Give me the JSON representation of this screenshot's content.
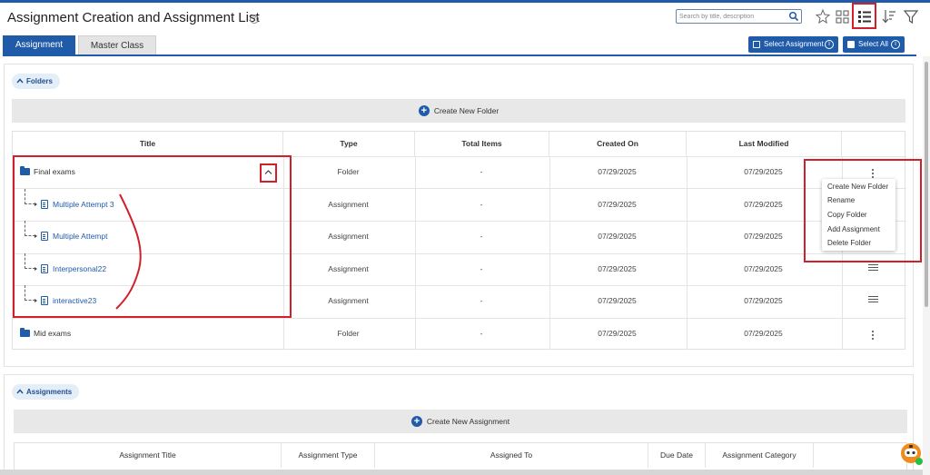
{
  "header": {
    "title": "Assignment Creation and Assignment List",
    "help_icon": "?",
    "search_placeholder": "Search by title, description"
  },
  "tabs": [
    {
      "label": "Assignment",
      "active": true
    },
    {
      "label": "Master Class",
      "active": false
    }
  ],
  "actions": {
    "select_assignment": "Select Assignment",
    "select_all": "Select All"
  },
  "folders_section": {
    "chip": "Folders",
    "create_label": "Create New Folder",
    "columns": [
      "Title",
      "Type",
      "Total Items",
      "Created On",
      "Last Modified"
    ],
    "rows": [
      {
        "title": "Final exams",
        "type": "Folder",
        "total": "-",
        "created": "07/29/2025",
        "modified": "07/29/2025"
      },
      {
        "title": "Multiple Attempt 3",
        "type": "Assignment",
        "total": "-",
        "created": "07/29/2025",
        "modified": "07/29/2025"
      },
      {
        "title": "Multiple Attempt",
        "type": "Assignment",
        "total": "-",
        "created": "07/29/2025",
        "modified": "07/29/2025"
      },
      {
        "title": "Interpersonal22",
        "type": "Assignment",
        "total": "-",
        "created": "07/29/2025",
        "modified": "07/29/2025"
      },
      {
        "title": "interactive23",
        "type": "Assignment",
        "total": "-",
        "created": "07/29/2025",
        "modified": "07/29/2025"
      },
      {
        "title": "Mid exams",
        "type": "Folder",
        "total": "-",
        "created": "07/29/2025",
        "modified": "07/29/2025"
      }
    ]
  },
  "context_menu": {
    "items": [
      "Create New Folder",
      "Rename",
      "Copy Folder",
      "Add Assignment",
      "Delete Folder"
    ]
  },
  "assignments_section": {
    "chip": "Assignments",
    "create_label": "Create New Assignment",
    "columns": [
      "Assignment Title",
      "Assignment Type",
      "Assigned To",
      "Due Date",
      "Assignment Category"
    ]
  },
  "colors": {
    "primary": "#1f5ba8",
    "highlight": "#d0202b"
  }
}
